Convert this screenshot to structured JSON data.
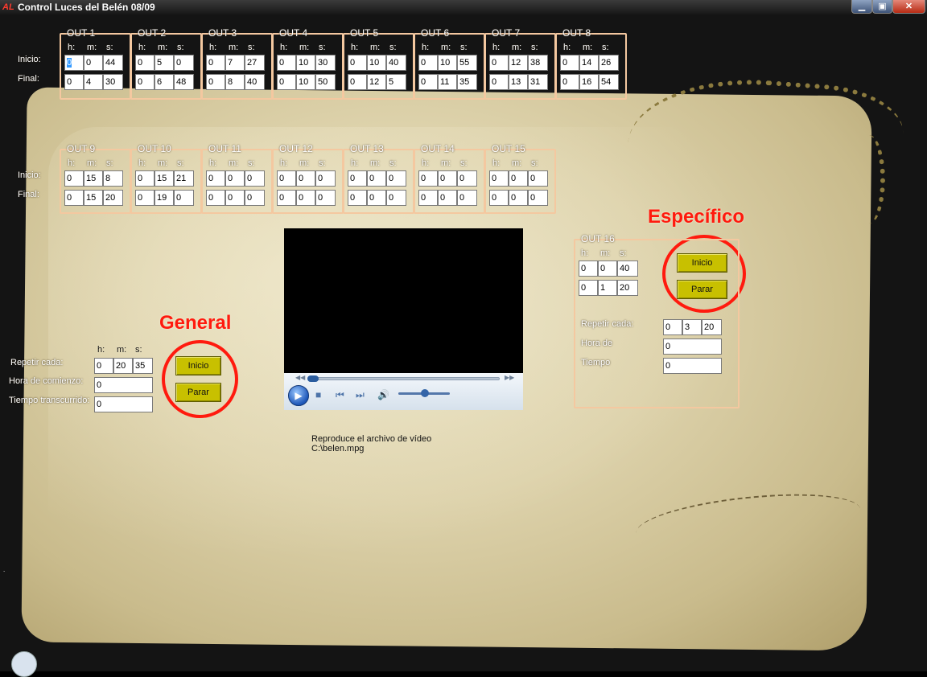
{
  "window": {
    "app_icon_text": "AL",
    "title": "Control Luces del Belén 08/09",
    "minimize": "▁",
    "maximize": "▣",
    "close": "✕"
  },
  "labels": {
    "inicio": "Inicio:",
    "final": "Final:",
    "h": "h:",
    "m": "m:",
    "s": "s:"
  },
  "outputs": [
    {
      "name": "OUT 1",
      "inicio": [
        "0",
        "0",
        "44"
      ],
      "final": [
        "0",
        "4",
        "30"
      ]
    },
    {
      "name": "OUT 2",
      "inicio": [
        "0",
        "5",
        "0"
      ],
      "final": [
        "0",
        "6",
        "48"
      ]
    },
    {
      "name": "OUT 3",
      "inicio": [
        "0",
        "7",
        "27"
      ],
      "final": [
        "0",
        "8",
        "40"
      ]
    },
    {
      "name": "OUT 4",
      "inicio": [
        "0",
        "10",
        "30"
      ],
      "final": [
        "0",
        "10",
        "50"
      ]
    },
    {
      "name": "OUT 5",
      "inicio": [
        "0",
        "10",
        "40"
      ],
      "final": [
        "0",
        "12",
        "5"
      ]
    },
    {
      "name": "OUT 6",
      "inicio": [
        "0",
        "10",
        "55"
      ],
      "final": [
        "0",
        "11",
        "35"
      ]
    },
    {
      "name": "OUT 7",
      "inicio": [
        "0",
        "12",
        "38"
      ],
      "final": [
        "0",
        "13",
        "31"
      ]
    },
    {
      "name": "OUT 8",
      "inicio": [
        "0",
        "14",
        "26"
      ],
      "final": [
        "0",
        "16",
        "54"
      ]
    },
    {
      "name": "OUT 9",
      "inicio": [
        "0",
        "15",
        "8"
      ],
      "final": [
        "0",
        "15",
        "20"
      ]
    },
    {
      "name": "OUT 10",
      "inicio": [
        "0",
        "15",
        "21"
      ],
      "final": [
        "0",
        "19",
        "0"
      ]
    },
    {
      "name": "OUT 11",
      "inicio": [
        "0",
        "0",
        "0"
      ],
      "final": [
        "0",
        "0",
        "0"
      ]
    },
    {
      "name": "OUT 12",
      "inicio": [
        "0",
        "0",
        "0"
      ],
      "final": [
        "0",
        "0",
        "0"
      ]
    },
    {
      "name": "OUT 13",
      "inicio": [
        "0",
        "0",
        "0"
      ],
      "final": [
        "0",
        "0",
        "0"
      ]
    },
    {
      "name": "OUT 14",
      "inicio": [
        "0",
        "0",
        "0"
      ],
      "final": [
        "0",
        "0",
        "0"
      ]
    },
    {
      "name": "OUT 15",
      "inicio": [
        "0",
        "0",
        "0"
      ],
      "final": [
        "0",
        "0",
        "0"
      ]
    }
  ],
  "general": {
    "heading": "General",
    "repetir_label": "Repetir cada:",
    "repetir": [
      "0",
      "20",
      "35"
    ],
    "hora_label": "Hora de comienzo:",
    "hora": "0",
    "tiempo_label": "Tiempo transcurrido:",
    "tiempo": "0",
    "inicio_button": "Inicio",
    "parar_button": "Parar"
  },
  "especifico": {
    "heading": "Específico",
    "group": "OUT 16",
    "inicio": [
      "0",
      "0",
      "40"
    ],
    "final": [
      "0",
      "1",
      "20"
    ],
    "repetir_label": "Repetir cada:",
    "repetir": [
      "0",
      "3",
      "20"
    ],
    "hora_label": "Hora de",
    "hora": "0",
    "tiempo_label": "Tiempo",
    "tiempo": "0",
    "inicio_button": "Inicio",
    "parar_button": "Parar"
  },
  "player": {
    "caption_line1": "Reproduce el archivo de vídeo",
    "caption_line2": "C:\\belen.mpg",
    "position": 0.0,
    "volume": 0.5
  },
  "colors": {
    "accent_red": "#ff1a0e",
    "button_yellow": "#c8c000",
    "group_border": "#f4c8a0"
  }
}
